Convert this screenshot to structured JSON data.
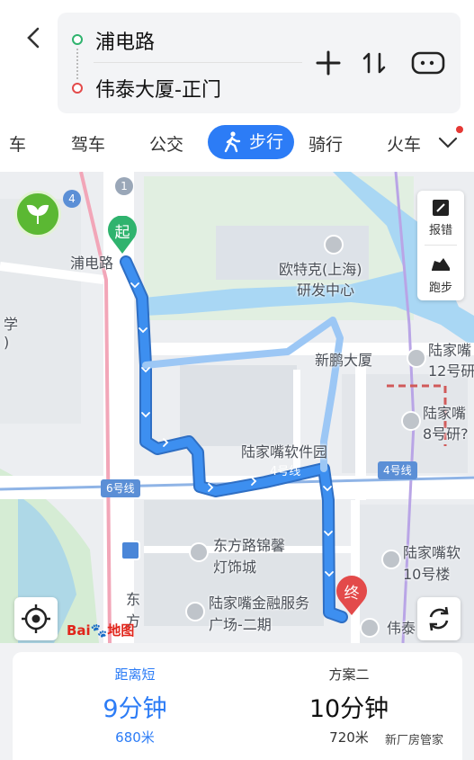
{
  "header": {
    "start": "浦电路",
    "end": "伟泰大厦-正门",
    "icons": [
      "back-arrow-icon",
      "plus-icon",
      "swap-icon",
      "more-icon"
    ]
  },
  "tabs": {
    "items": [
      "车",
      "驾车",
      "公交",
      "步行",
      "骑行",
      "火车"
    ],
    "active": "步行"
  },
  "map": {
    "labels": {
      "pudian_road": "浦电路",
      "outek_1": "欧特克(上海)",
      "outek_2": "研发中心",
      "xinpeng": "新鹏大厦",
      "lujiazui_12_1": "陆家嘴",
      "lujiazui_12_2": "12号研",
      "lujiazui_8_1": "陆家嘴",
      "lujiazui_8_2": "8号研?",
      "software_park": "陆家嘴软件园",
      "line4_station": "4号线",
      "line4_tag": "4号线",
      "line6_tag": "6号线",
      "line4_small": "4",
      "line1_small": "1",
      "dongfang_1": "东方路锦馨",
      "dongfang_2": "灯饰城",
      "finance_1": "陆家嘴金融服务",
      "finance_2": "广场-二期",
      "lujiazui_10_1": "陆家嘴软",
      "lujiazui_10_2": "10号楼",
      "weitai": "伟泰",
      "dongfang_road_1": "东",
      "dongfang_road_2": "方",
      "xue": "学",
      "paren": ")"
    },
    "start_marker": "起",
    "end_marker": "终",
    "tools": {
      "report": "报错",
      "run": "跑步"
    },
    "logo_a": "Bai",
    "logo_b": "地图",
    "route_color": "#3d8ff0"
  },
  "options": [
    {
      "name": "距离短",
      "time": "9分钟",
      "distance": "680米",
      "selected": true
    },
    {
      "name": "方案二",
      "time": "10分钟",
      "distance": "720米",
      "selected": false
    }
  ],
  "watermark": "新厂房管家",
  "colors": {
    "accent": "#2c7cf6",
    "start_green": "#2fb36e",
    "end_red": "#e34a4a"
  }
}
